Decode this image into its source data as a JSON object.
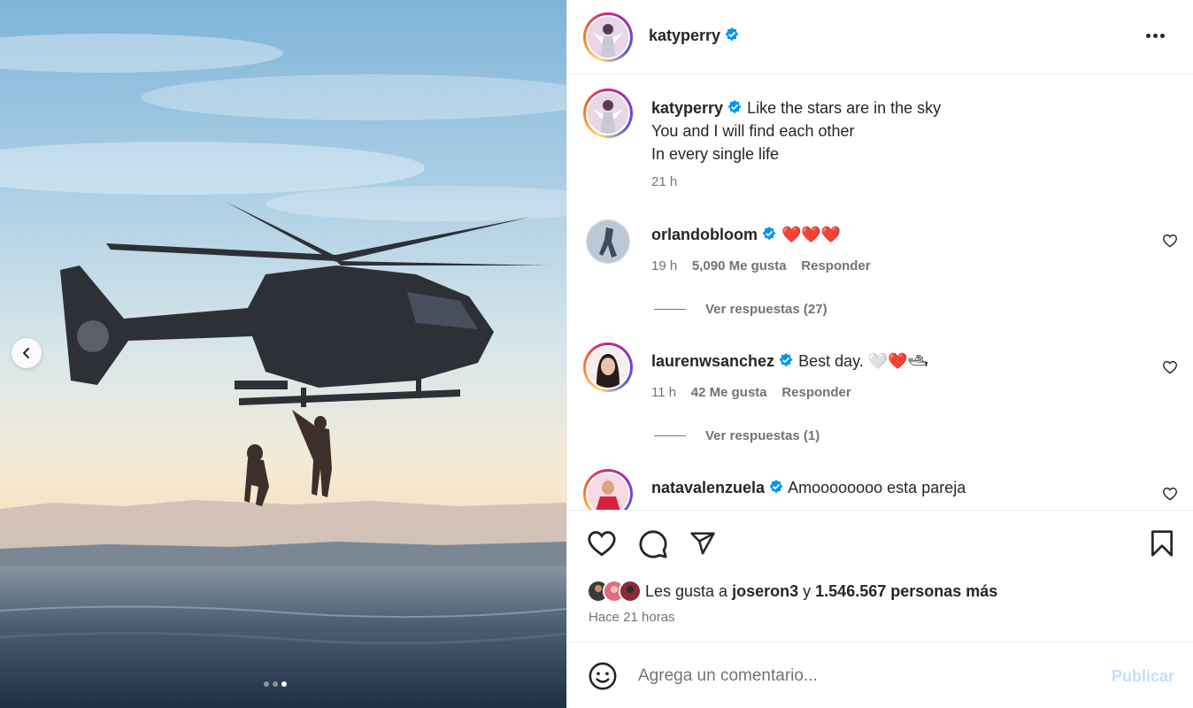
{
  "post": {
    "author": "katyperry",
    "verified_color": "#0095f6",
    "caption_lines": [
      "Like the stars are in the sky",
      "You and I will find each other",
      "In every single life"
    ],
    "caption_time": "21 h"
  },
  "media": {
    "prev_icon": "chevron-left-icon",
    "slides": 3,
    "active_slide": 3
  },
  "comments": [
    {
      "user": "orlandobloom",
      "text": "❤️❤️❤️",
      "time": "19 h",
      "likes": "5,090 Me gusta",
      "reply": "Responder",
      "view_replies": "Ver respuestas (27)"
    },
    {
      "user": "laurenwsanchez",
      "text": "Best day. 🤍❤️🛥",
      "time": "11 h",
      "likes": "42 Me gusta",
      "reply": "Responder",
      "view_replies": "Ver respuestas (1)"
    },
    {
      "user": "natavalenzuela",
      "text": "Amoooooooo esta pareja"
    }
  ],
  "likes": {
    "prefix": "Les gusta a",
    "user": "joseron3",
    "connector": "y",
    "others": "1.546.567 personas más",
    "time": "Hace 21 horas"
  },
  "composer": {
    "placeholder": "Agrega un comentario...",
    "publish": "Publicar"
  }
}
